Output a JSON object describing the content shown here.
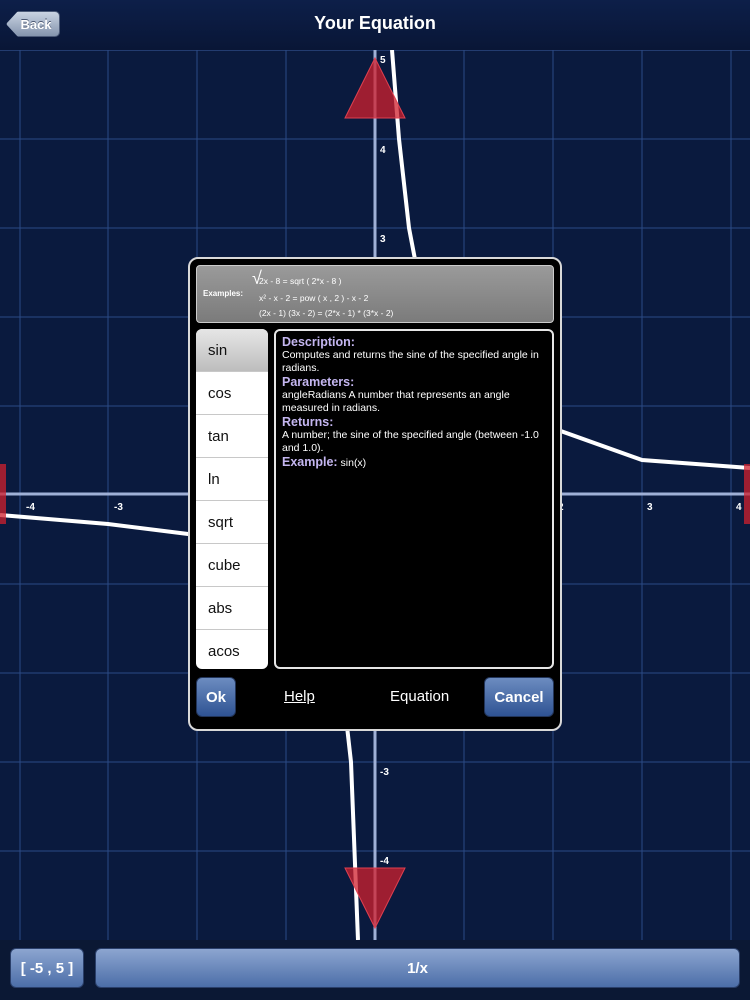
{
  "header": {
    "back_label": "Back",
    "title": "Your Equation"
  },
  "graph": {
    "x_ticks": [
      "-4",
      "-3",
      "2",
      "3",
      "4"
    ],
    "y_ticks": [
      "5",
      "4",
      "3",
      "-3",
      "-4"
    ],
    "curve_color": "#ffffff",
    "grid_color": "#2b4a85",
    "arrow_color": "#d0202e"
  },
  "dialog": {
    "examples_label": "Examples:",
    "examples": [
      "2x - 8  =  sqrt ( 2*x - 8 )",
      "x² - x - 2  =  pow ( x , 2 ) - x - 2",
      "(2x - 1) (3x - 2)  =  (2*x - 1) * (3*x - 2)"
    ],
    "functions": [
      "sin",
      "cos",
      "tan",
      "ln",
      "sqrt",
      "cube",
      "abs",
      "acos"
    ],
    "selected_function": "sin",
    "description_heading": "Description:",
    "description_text": "Computes and returns the sine of the specified angle in radians.",
    "parameters_heading": "Parameters:",
    "parameters_text": "angleRadians A number that represents an angle measured in radians.",
    "returns_heading": "Returns:",
    "returns_text": "A number; the sine of the specified angle (between -1.0 and 1.0).",
    "example_heading": "Example:",
    "example_text": "sin(x)",
    "ok_label": "Ok",
    "help_label": "Help",
    "equation_label": "Equation",
    "cancel_label": "Cancel"
  },
  "bottom": {
    "range_label": "[ -5 , 5 ]",
    "function_label": "1/x"
  }
}
